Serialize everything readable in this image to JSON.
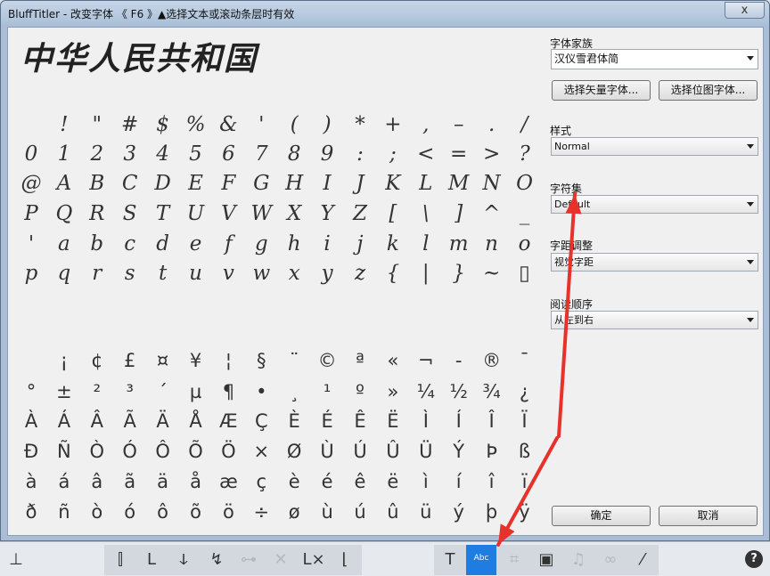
{
  "window": {
    "title": "BluffTitler - 改变字体   《 F6 》▲选择文本或滚动条层时有效",
    "close_label": "x"
  },
  "preview": {
    "sample_text": "中华人民共和国",
    "rows": [
      [
        " ",
        "!",
        "\"",
        "#",
        "$",
        "%",
        "&",
        "'",
        "(",
        ")",
        "*",
        "+",
        ",",
        "–",
        ".",
        "/"
      ],
      [
        "0",
        "1",
        "2",
        "3",
        "4",
        "5",
        "6",
        "7",
        "8",
        "9",
        ":",
        ";",
        "<",
        "=",
        ">",
        "?"
      ],
      [
        "@",
        "A",
        "B",
        "C",
        "D",
        "E",
        "F",
        "G",
        "H",
        "I",
        "J",
        "K",
        "L",
        "M",
        "N",
        "O"
      ],
      [
        "P",
        "Q",
        "R",
        "S",
        "T",
        "U",
        "V",
        "W",
        "X",
        "Y",
        "Z",
        "[",
        "\\",
        "]",
        "^",
        "_"
      ],
      [
        "'",
        "a",
        "b",
        "c",
        "d",
        "e",
        "f",
        "g",
        "h",
        "i",
        "j",
        "k",
        "l",
        "m",
        "n",
        "o"
      ],
      [
        "p",
        "q",
        "r",
        "s",
        "t",
        "u",
        "v",
        "w",
        "x",
        "y",
        "z",
        "{",
        "|",
        "}",
        "~",
        "▯"
      ],
      [
        " ",
        "¡",
        "¢",
        "£",
        "¤",
        "¥",
        "¦",
        "§",
        "¨",
        "©",
        "ª",
        "«",
        "¬",
        "-",
        "®",
        "¯"
      ],
      [
        "°",
        "±",
        "²",
        "³",
        "´",
        "µ",
        "¶",
        "•",
        "¸",
        "¹",
        "º",
        "»",
        "¼",
        "½",
        "¾",
        "¿"
      ],
      [
        "À",
        "Á",
        "Â",
        "Ã",
        "Ä",
        "Å",
        "Æ",
        "Ç",
        "È",
        "É",
        "Ê",
        "Ë",
        "Ì",
        "Í",
        "Î",
        "Ï"
      ],
      [
        "Đ",
        "Ñ",
        "Ò",
        "Ó",
        "Ô",
        "Õ",
        "Ö",
        "×",
        "Ø",
        "Ù",
        "Ú",
        "Û",
        "Ü",
        "Ý",
        "Þ",
        "ß"
      ],
      [
        "à",
        "á",
        "â",
        "ã",
        "ä",
        "å",
        "æ",
        "ç",
        "è",
        "é",
        "ê",
        "ë",
        "ì",
        "í",
        "î",
        "ï"
      ],
      [
        "ð",
        "ñ",
        "ò",
        "ó",
        "ô",
        "õ",
        "ö",
        "÷",
        "ø",
        "ù",
        "ú",
        "û",
        "ü",
        "ý",
        "þ",
        "ÿ"
      ]
    ]
  },
  "side": {
    "font_family_label": "字体家族",
    "font_family_value": "汉仪雪君体简",
    "vector_button": "选择矢量字体...",
    "bitmap_button": "选择位图字体...",
    "style_label": "样式",
    "style_value": "Normal",
    "charset_label": "字符集",
    "charset_value": "Default",
    "spacing_label": "字距调整",
    "spacing_value": "视觉字距",
    "reading_label": "阅读顺序",
    "reading_value": "从左到右",
    "ok_button": "确定",
    "cancel_button": "取消"
  },
  "toolbar": {
    "abc_label": "Abc",
    "help_label": "?"
  },
  "colors": {
    "highlight": "#1f7ce0",
    "annotation_arrow": "#e8312a"
  }
}
